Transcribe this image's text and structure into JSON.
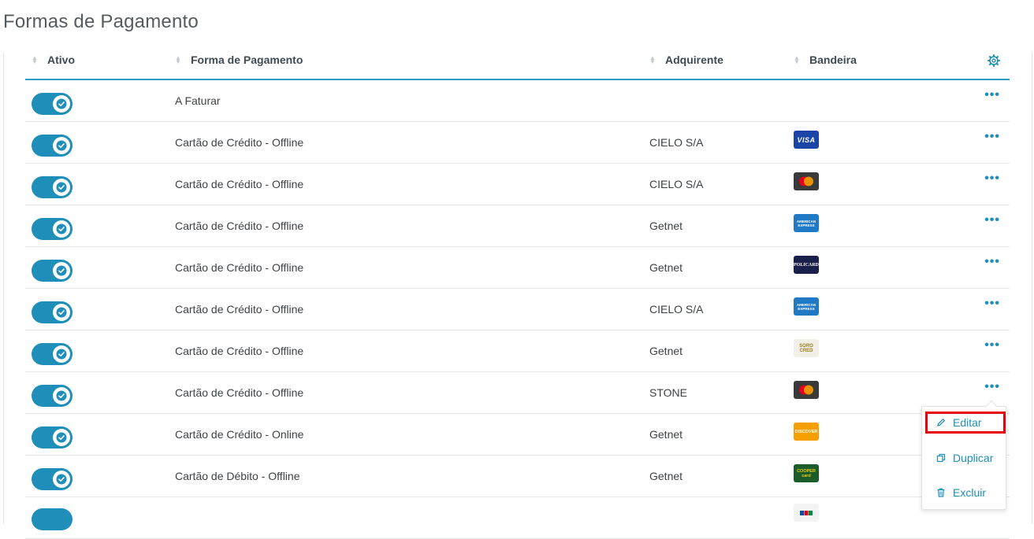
{
  "page": {
    "title": "Formas de Pagamento"
  },
  "table": {
    "headers": {
      "ativo": "Ativo",
      "forma": "Forma de Pagamento",
      "adquirente": "Adquirente",
      "bandeira": "Bandeira"
    },
    "rows": [
      {
        "ativo": true,
        "forma": "A Faturar",
        "adquirente": "",
        "bandeira": ""
      },
      {
        "ativo": true,
        "forma": "Cartão de Crédito - Offline",
        "adquirente": "CIELO S/A",
        "bandeira": "VISA"
      },
      {
        "ativo": true,
        "forma": "Cartão de Crédito - Offline",
        "adquirente": "CIELO S/A",
        "bandeira": "mastercard"
      },
      {
        "ativo": true,
        "forma": "Cartão de Crédito - Offline",
        "adquirente": "Getnet",
        "bandeira": "AMERICAN EXPRESS"
      },
      {
        "ativo": true,
        "forma": "Cartão de Crédito - Offline",
        "adquirente": "Getnet",
        "bandeira": "POLICARD"
      },
      {
        "ativo": true,
        "forma": "Cartão de Crédito - Offline",
        "adquirente": "CIELO S/A",
        "bandeira": "AMERICAN EXPRESS"
      },
      {
        "ativo": true,
        "forma": "Cartão de Crédito - Offline",
        "adquirente": "Getnet",
        "bandeira": "SORO CRED"
      },
      {
        "ativo": true,
        "forma": "Cartão de Crédito - Offline",
        "adquirente": "STONE",
        "bandeira": "mastercard"
      },
      {
        "ativo": true,
        "forma": "Cartão de Crédito - Online",
        "adquirente": "Getnet",
        "bandeira": "DISCOVER"
      },
      {
        "ativo": true,
        "forma": "Cartão de Débito - Offline",
        "adquirente": "Getnet",
        "bandeira": "COOPER card"
      }
    ]
  },
  "dropdown": {
    "items": [
      {
        "label": "Editar",
        "icon": "pencil-icon"
      },
      {
        "label": "Duplicar",
        "icon": "copy-icon"
      },
      {
        "label": "Excluir",
        "icon": "trash-icon"
      }
    ]
  },
  "colors": {
    "accent": "#1f8fba",
    "highlight": "#e8000b"
  }
}
